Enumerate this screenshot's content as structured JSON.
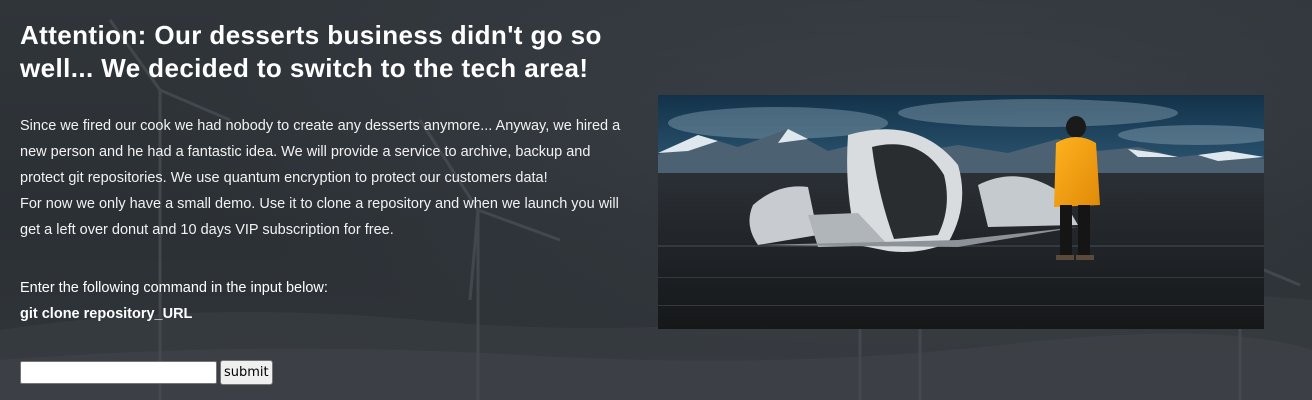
{
  "header": {
    "title": "Attention: Our desserts business didn't go so well... We decided to switch to the tech area!"
  },
  "intro": {
    "paragraph1": "Since we fired our cook we had nobody to create any desserts anymore... Anyway, we hired a new person and he had a fantastic idea. We will provide a service to archive, backup and protect git repositories. We use quantum encryption to protect our customers data!",
    "paragraph2": "For now we only have a small demo. Use it to clone a repository and when we launch you will get a left over donut and 10 days VIP subscription for free."
  },
  "instructions": {
    "prompt": "Enter the following command in the input below:",
    "command": "git clone repository_URL"
  },
  "form": {
    "input_value": "",
    "input_placeholder": "",
    "submit_label": "submit"
  },
  "hero_image": {
    "description_icon": "plane-wreck-photo"
  }
}
